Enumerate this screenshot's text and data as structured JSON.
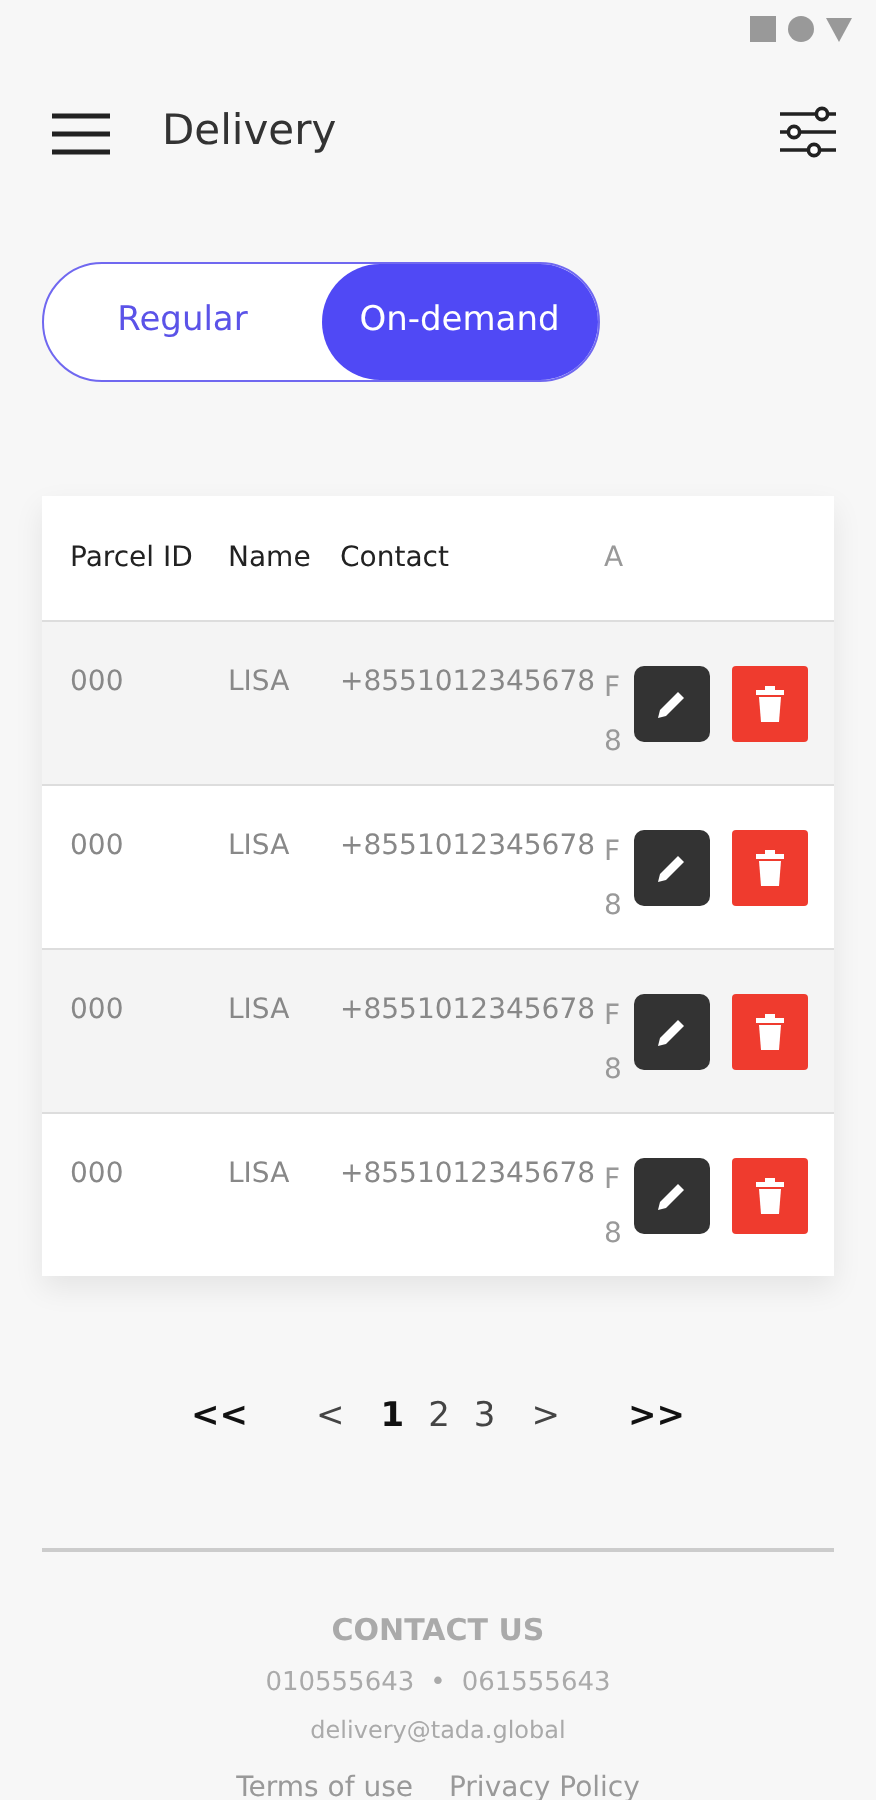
{
  "header": {
    "title": "Delivery"
  },
  "tabs": [
    {
      "label": "Regular",
      "selected": false
    },
    {
      "label": "On-demand",
      "selected": true
    }
  ],
  "table": {
    "columns": [
      "Parcel ID",
      "Name",
      "Contact",
      "A"
    ],
    "rows": [
      {
        "parcel_id": "000",
        "name": "LISA",
        "contact": "+8551012345678",
        "column_4": [
          "F",
          "8"
        ]
      },
      {
        "parcel_id": "000",
        "name": "LISA",
        "contact": "+8551012345678",
        "column_4": [
          "F",
          "8"
        ]
      },
      {
        "parcel_id": "000",
        "name": "LISA",
        "contact": "+8551012345678",
        "column_4": [
          "F",
          "8"
        ]
      },
      {
        "parcel_id": "000",
        "name": "LISA",
        "contact": "+8551012345678",
        "column_4": [
          "F",
          "8"
        ]
      }
    ]
  },
  "pagination": [
    {
      "label": "<<",
      "kind": "jump"
    },
    {
      "label": "<",
      "kind": "step"
    },
    {
      "label": "1",
      "kind": "page",
      "selected": true
    },
    {
      "label": "2",
      "kind": "page",
      "selected": false
    },
    {
      "label": "3",
      "kind": "page",
      "selected": false
    },
    {
      "label": ">",
      "kind": "step"
    },
    {
      "label": ">>",
      "kind": "jump"
    }
  ],
  "footer": {
    "heading": "CONTACT US",
    "phones": [
      "010555643",
      "061555643"
    ],
    "separator": "•",
    "email": "delivery@tada.global",
    "links": [
      "Terms of use",
      "Privacy Policy"
    ]
  }
}
